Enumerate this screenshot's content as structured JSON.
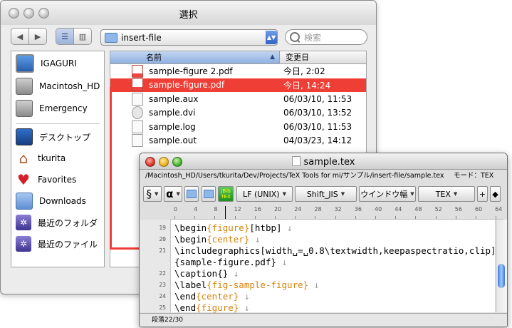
{
  "dialog": {
    "title": "選択",
    "back_icon": "back-arrow-icon",
    "forward_icon": "forward-arrow-icon",
    "folder_popup": "insert-file",
    "search_placeholder": "検索",
    "sidebar": [
      {
        "label": "IGAGURI",
        "icon": "computer-icon"
      },
      {
        "label": "Macintosh_HD",
        "icon": "hard-disk-icon"
      },
      {
        "label": "Emergency",
        "icon": "hard-disk-icon"
      },
      {
        "label": "デスクトップ",
        "icon": "desktop-icon"
      },
      {
        "label": "tkurita",
        "icon": "home-icon"
      },
      {
        "label": "Favorites",
        "icon": "heart-icon"
      },
      {
        "label": "Downloads",
        "icon": "folder-icon"
      },
      {
        "label": "最近のフォルダ",
        "icon": "recent-folders-icon"
      },
      {
        "label": "最近のファイル",
        "icon": "recent-files-icon"
      }
    ],
    "columns": {
      "name": "名前",
      "modified": "変更日"
    },
    "files": [
      {
        "name": "sample-figure 2.pdf",
        "date": "今日, 2:02",
        "kind": "pdf"
      },
      {
        "name": "sample-figure.pdf",
        "date": "今日, 14:24",
        "kind": "pdf",
        "selected": true
      },
      {
        "name": "sample.aux",
        "date": "06/03/10, 11:53",
        "kind": "doc"
      },
      {
        "name": "sample.dvi",
        "date": "06/03/10, 13:52",
        "kind": "dvi"
      },
      {
        "name": "sample.log",
        "date": "06/03/10, 11:53",
        "kind": "doc"
      },
      {
        "name": "sample.out",
        "date": "04/03/23, 14:12",
        "kind": "doc"
      }
    ]
  },
  "editor": {
    "title": "sample.tex",
    "path": "/Macintosh_HD/Users/tkurita/Dev/Projects/TeX Tools for mi/サンプル/insert-file/sample.tex",
    "mode": "モード：TEX",
    "toolbar": {
      "line_ending": "LF (UNIX)",
      "encoding": "Shift_JIS",
      "window_width": "ウインドウ幅",
      "mode": "TEX",
      "jbib_label": "JBib TEX"
    },
    "ruler_labels": [
      "0",
      "4",
      "8",
      "12",
      "16",
      "20",
      "24",
      "28",
      "32",
      "36",
      "40",
      "44",
      "48",
      "52",
      "56",
      "60",
      "64"
    ],
    "lines": [
      {
        "num": "19",
        "cmd": "\\begin",
        "arg": "{figure}",
        "rest": "[htbp]",
        "mark": "↓"
      },
      {
        "num": "20",
        "cmd": "\\begin",
        "arg": "{center}",
        "rest": "",
        "mark": "↓"
      },
      {
        "num": "21",
        "cmd": "\\includegraphics",
        "arg": "",
        "rest": "[width␣=␣0.8\\textwidth,keepaspectratio,clip]",
        "mark": ""
      },
      {
        "num": "",
        "cmd": "",
        "arg": "",
        "rest": "{sample-figure.pdf}",
        "mark": "↓"
      },
      {
        "num": "22",
        "cmd": "\\caption",
        "arg": "",
        "rest": "{}",
        "mark": "↓"
      },
      {
        "num": "23",
        "cmd": "\\label",
        "arg": "{fig-sample-figure}",
        "rest": "",
        "mark": "↓"
      },
      {
        "num": "24",
        "cmd": "\\end",
        "arg": "{center}",
        "rest": "",
        "mark": "↓"
      },
      {
        "num": "25",
        "cmd": "\\end",
        "arg": "{figure}",
        "rest": "",
        "mark": "↓"
      }
    ],
    "status": "段落22/30"
  },
  "colors": {
    "selection": "#ef3e36",
    "brace": "#d8820c",
    "arrow": "#ef3e36"
  }
}
